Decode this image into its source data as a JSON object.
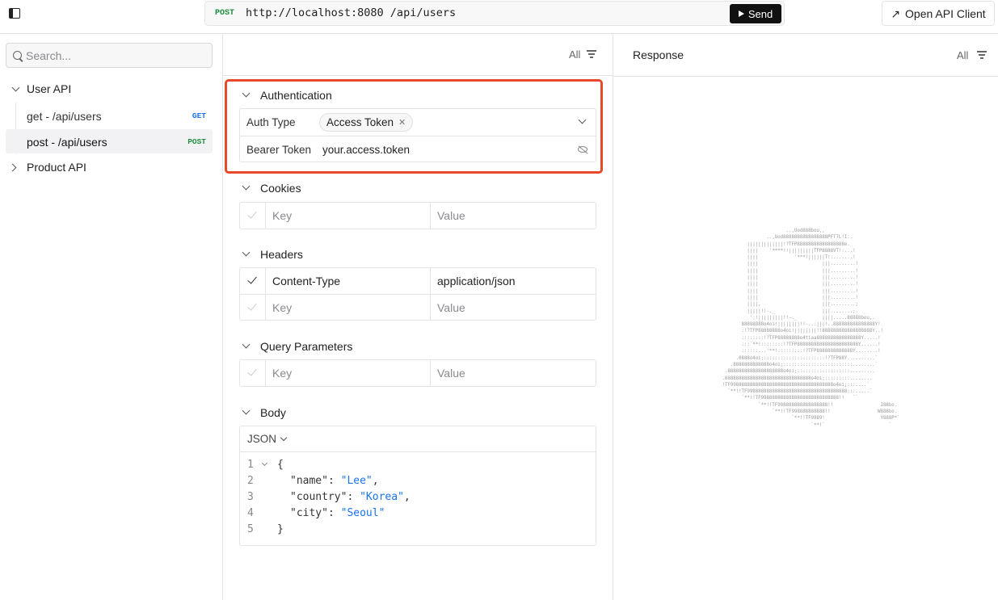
{
  "topbar": {
    "method": "POST",
    "url": "http://localhost:8080 /api/users",
    "send_label": "Send",
    "open_client_label": "Open API Client"
  },
  "sidebar": {
    "search_placeholder": "Search...",
    "groups": [
      {
        "label": "User API",
        "expanded": true,
        "items": [
          {
            "label": "get - /api/users",
            "method": "GET",
            "active": false
          },
          {
            "label": "post - /api/users",
            "method": "POST",
            "active": true
          }
        ]
      },
      {
        "label": "Product API",
        "expanded": false,
        "items": []
      }
    ]
  },
  "request": {
    "filter_label": "All",
    "authentication": {
      "title": "Authentication",
      "auth_type_label": "Auth Type",
      "auth_type_value": "Access Token",
      "bearer_label": "Bearer Token",
      "bearer_value": "your.access.token"
    },
    "cookies": {
      "title": "Cookies",
      "rows": [
        {
          "key": "",
          "value": "",
          "enabled": false
        }
      ]
    },
    "headers": {
      "title": "Headers",
      "rows": [
        {
          "key": "Content-Type",
          "value": "application/json",
          "enabled": true
        },
        {
          "key": "",
          "value": "",
          "enabled": false
        }
      ]
    },
    "query": {
      "title": "Query Parameters",
      "rows": [
        {
          "key": "",
          "value": "",
          "enabled": false
        }
      ]
    },
    "key_placeholder": "Key",
    "value_placeholder": "Value",
    "body": {
      "title": "Body",
      "format": "JSON",
      "lines": [
        {
          "n": "1",
          "text": "{"
        },
        {
          "n": "2",
          "key": "\"name\"",
          "val": "\"Lee\"",
          "tail": ","
        },
        {
          "n": "3",
          "key": "\"country\"",
          "val": "\"Korea\"",
          "tail": ","
        },
        {
          "n": "4",
          "key": "\"city\"",
          "val": "\"Seoul\"",
          "tail": ""
        },
        {
          "n": "5",
          "text": "}"
        }
      ]
    }
  },
  "response": {
    "title": "Response",
    "filter_label": "All"
  },
  "colors": {
    "highlight": "#e8492b",
    "get": "#1a73e8",
    "post": "#1e8e3e",
    "string": "#1a73e8"
  }
}
